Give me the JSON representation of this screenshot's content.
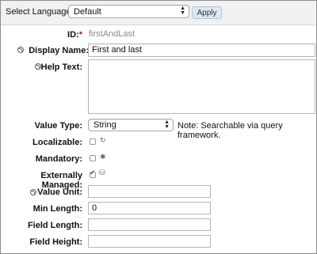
{
  "topbar": {
    "language_label": "Select Language:",
    "language_value": "Default",
    "apply_label": "Apply"
  },
  "form": {
    "id_label": "ID:",
    "id_required_mark": "*",
    "id_value": "firstAndLast",
    "display_name_label": "Display Name:",
    "display_name_value": "First and last",
    "help_text_label": "Help Text:",
    "help_text_value": "",
    "value_type_label": "Value Type:",
    "value_type_value": "String",
    "value_type_note": "Note: Searchable via query framework.",
    "localizable_label": "Localizable:",
    "localizable_checked": false,
    "mandatory_label": "Mandatory:",
    "mandatory_checked": false,
    "externally_managed_label": "Externally Managed:",
    "externally_managed_checked": true,
    "value_unit_label": "Value Unit:",
    "value_unit_value": "",
    "min_length_label": "Min Length:",
    "min_length_value": "0",
    "field_length_label": "Field Length:",
    "field_length_value": "",
    "field_height_label": "Field Height:",
    "field_height_value": ""
  },
  "icons": {
    "help": "help-icon",
    "localizable": "refresh-icon",
    "mandatory": "asterisk-icon",
    "externally_managed": "external-system-icon"
  }
}
